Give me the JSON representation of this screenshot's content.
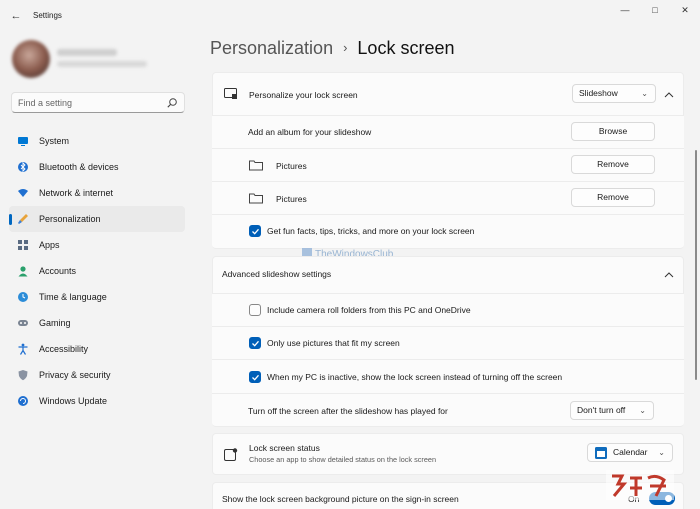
{
  "window": {
    "title": "Settings",
    "back_glyph": "←",
    "minimize_glyph": "—",
    "maximize_glyph": "□",
    "close_glyph": "✕"
  },
  "search": {
    "placeholder": "Find a setting"
  },
  "sidebar": {
    "items": [
      {
        "label": "System",
        "icon": "system-icon"
      },
      {
        "label": "Bluetooth & devices",
        "icon": "bluetooth-icon"
      },
      {
        "label": "Network & internet",
        "icon": "wifi-icon"
      },
      {
        "label": "Personalization",
        "icon": "brush-icon",
        "active": true
      },
      {
        "label": "Apps",
        "icon": "apps-icon"
      },
      {
        "label": "Accounts",
        "icon": "person-icon"
      },
      {
        "label": "Time & language",
        "icon": "globe-clock-icon"
      },
      {
        "label": "Gaming",
        "icon": "gamepad-icon"
      },
      {
        "label": "Accessibility",
        "icon": "accessibility-icon"
      },
      {
        "label": "Privacy & security",
        "icon": "shield-icon"
      },
      {
        "label": "Windows Update",
        "icon": "update-icon"
      }
    ]
  },
  "breadcrumb": {
    "parent": "Personalization",
    "separator": "›",
    "current": "Lock screen"
  },
  "lock_screen": {
    "personalize_label": "Personalize your lock screen",
    "personalize_value": "Slideshow",
    "add_album_label": "Add an album for your slideshow",
    "browse_label": "Browse",
    "albums": [
      {
        "name": "Pictures",
        "action": "Remove"
      },
      {
        "name": "Pictures",
        "action": "Remove"
      }
    ],
    "fun_facts_label": "Get fun facts, tips, tricks, and more on your lock screen"
  },
  "advanced": {
    "heading": "Advanced slideshow settings",
    "options": [
      {
        "label": "Include camera roll folders from this PC and OneDrive",
        "checked": false
      },
      {
        "label": "Only use pictures that fit my screen",
        "checked": true
      },
      {
        "label": "When my PC is inactive, show the lock screen instead of turning off the screen",
        "checked": true
      }
    ],
    "turn_off_label": "Turn off the screen after the slideshow has played for",
    "turn_off_value": "Don't turn off"
  },
  "status": {
    "label": "Lock screen status",
    "sub": "Choose an app to show detailed status on the lock screen",
    "value": "Calendar"
  },
  "signin": {
    "label": "Show the lock screen background picture on the sign-in screen",
    "state": "On"
  },
  "watermark": "TheWindowsClub",
  "accent": "#005fb8"
}
